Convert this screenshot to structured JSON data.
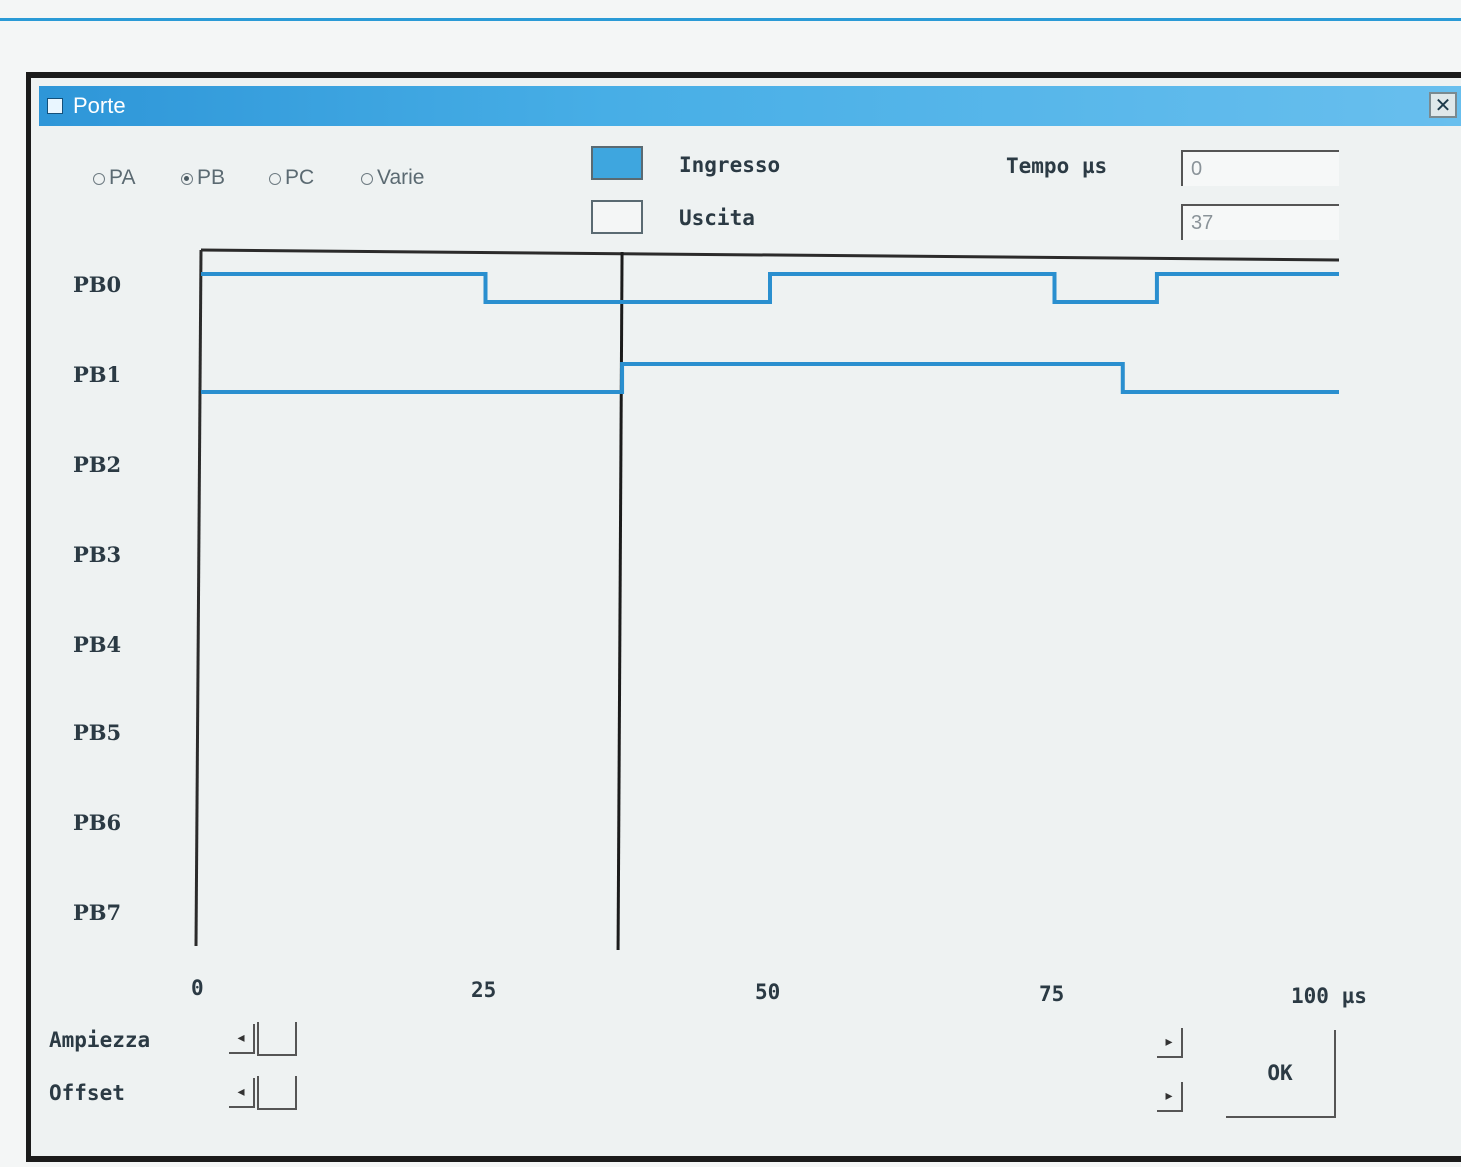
{
  "window": {
    "title": "Porte",
    "close_glyph": "✕"
  },
  "ports": {
    "options": [
      {
        "label": "PA",
        "selected": false
      },
      {
        "label": "PB",
        "selected": true
      },
      {
        "label": "PC",
        "selected": false
      },
      {
        "label": "Varie",
        "selected": false
      }
    ]
  },
  "legend": {
    "input_label": "Ingresso",
    "input_color": "#3ea6df",
    "output_label": "Uscita",
    "output_color": "#f4f6f6"
  },
  "time": {
    "label": "Tempo µs",
    "start_value": "0",
    "cursor_value": "37"
  },
  "channels": [
    "PB0",
    "PB1",
    "PB2",
    "PB3",
    "PB4",
    "PB5",
    "PB6",
    "PB7"
  ],
  "x_ticks": [
    "0",
    "25",
    "50",
    "75",
    "100 µs"
  ],
  "chart_data": {
    "type": "line",
    "title": "",
    "xlabel": "µs",
    "xlim": [
      0,
      100
    ],
    "cursor_x": 37,
    "signal_color": "#2a8fcf",
    "series": [
      {
        "channel": "PB0",
        "steps": [
          [
            0,
            1
          ],
          [
            25,
            0
          ],
          [
            50,
            1
          ],
          [
            75,
            0
          ],
          [
            84,
            1
          ],
          [
            100,
            1
          ]
        ]
      },
      {
        "channel": "PB1",
        "steps": [
          [
            0,
            0
          ],
          [
            37,
            1
          ],
          [
            81,
            0
          ],
          [
            100,
            0
          ]
        ]
      }
    ]
  },
  "controls": {
    "amplitude_label": "Ampiezza",
    "offset_label": "Offset",
    "left_arrow": "◂",
    "right_arrow": "▸",
    "ok_label": "OK"
  }
}
